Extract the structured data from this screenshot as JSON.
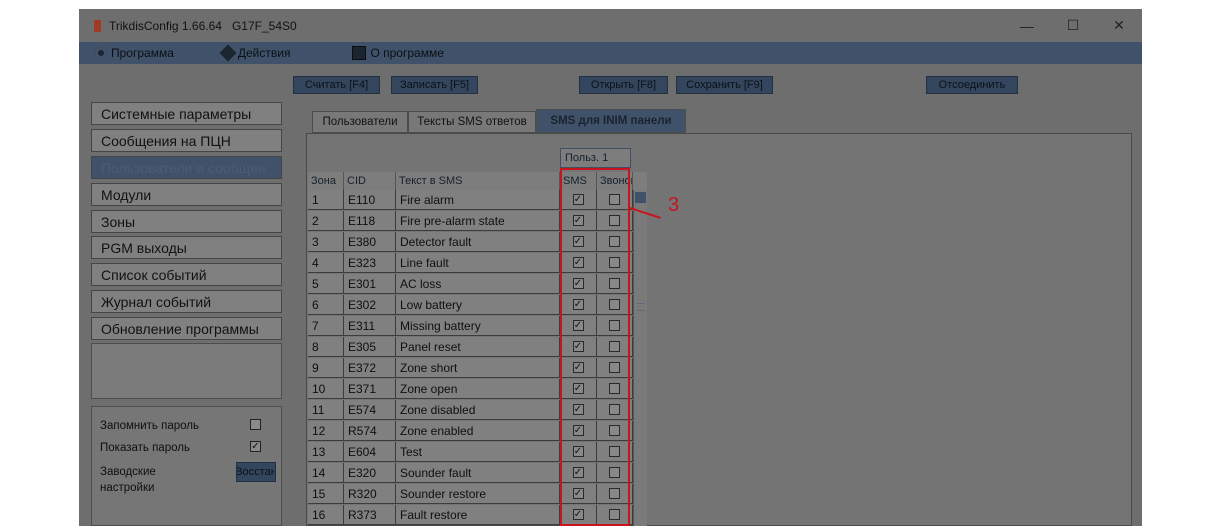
{
  "window": {
    "title": "TrikdisConfig 1.66.64",
    "subtitle": "G17F_54S0",
    "controls": {
      "minimize": "—",
      "maximize": "☐",
      "close": "✕"
    }
  },
  "menu": [
    {
      "label": "Программа",
      "icon": "gear-icon"
    },
    {
      "label": "Действия",
      "icon": "wrench-icon"
    },
    {
      "label": "О программе",
      "icon": "book-icon"
    }
  ],
  "toolbar": {
    "read": "Считать [F4]",
    "write": "Записать [F5]",
    "open": "Открыть [F8]",
    "save": "Сохранить [F9]",
    "disconnect": "Отсоединить"
  },
  "nav": [
    "Системные параметры",
    "Сообщения на ПЦН",
    "Пользователи и сообщен",
    "Модули",
    "Зоны",
    "PGM выходы",
    "Список событий",
    "Журнал событий",
    "Обновление программы"
  ],
  "nav_active_index": 2,
  "settings": {
    "remember_password": "Запомнить пароль",
    "remember_password_checked": false,
    "show_password": "Показать пароль",
    "show_password_checked": true,
    "factory_settings": "Заводские настройки",
    "restore": "Восстан"
  },
  "tabs": [
    "Пользователи",
    "Тексты SMS ответов",
    "SMS для INIM панели"
  ],
  "tab_active_index": 2,
  "table": {
    "user_group_header": "Польз. 1",
    "columns": [
      "Зона",
      "CID",
      "Текст в SMS",
      "SMS",
      "Звонок"
    ],
    "rows": [
      {
        "zone": "1",
        "cid": "E110",
        "text": "Fire alarm",
        "sms": true,
        "call": false
      },
      {
        "zone": "2",
        "cid": "E118",
        "text": "Fire pre-alarm state",
        "sms": true,
        "call": false
      },
      {
        "zone": "3",
        "cid": "E380",
        "text": "Detector fault",
        "sms": true,
        "call": false
      },
      {
        "zone": "4",
        "cid": "E323",
        "text": "Line fault",
        "sms": true,
        "call": false
      },
      {
        "zone": "5",
        "cid": "E301",
        "text": "AC loss",
        "sms": true,
        "call": false
      },
      {
        "zone": "6",
        "cid": "E302",
        "text": "Low battery",
        "sms": true,
        "call": false
      },
      {
        "zone": "7",
        "cid": "E311",
        "text": "Missing battery",
        "sms": true,
        "call": false
      },
      {
        "zone": "8",
        "cid": "E305",
        "text": "Panel reset",
        "sms": true,
        "call": false
      },
      {
        "zone": "9",
        "cid": "E372",
        "text": "Zone short",
        "sms": true,
        "call": false
      },
      {
        "zone": "10",
        "cid": "E371",
        "text": "Zone open",
        "sms": true,
        "call": false
      },
      {
        "zone": "11",
        "cid": "E574",
        "text": "Zone disabled",
        "sms": true,
        "call": false
      },
      {
        "zone": "12",
        "cid": "R574",
        "text": "Zone enabled",
        "sms": true,
        "call": false
      },
      {
        "zone": "13",
        "cid": "E604",
        "text": "Test",
        "sms": true,
        "call": false
      },
      {
        "zone": "14",
        "cid": "E320",
        "text": "Sounder fault",
        "sms": true,
        "call": false
      },
      {
        "zone": "15",
        "cid": "R320",
        "text": "Sounder restore",
        "sms": true,
        "call": false
      },
      {
        "zone": "16",
        "cid": "R373",
        "text": "Fault restore",
        "sms": true,
        "call": false
      }
    ]
  },
  "annotation": {
    "number": "3",
    "color": "#c8141e"
  }
}
